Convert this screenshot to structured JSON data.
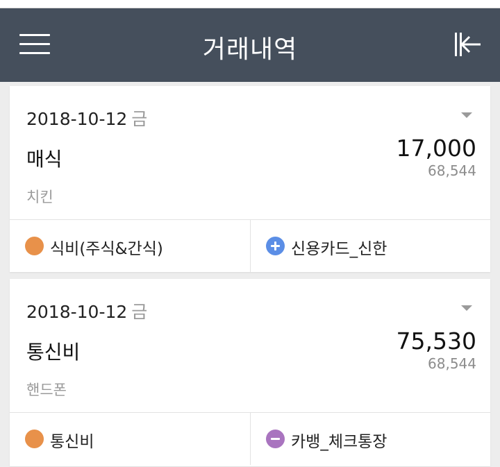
{
  "header": {
    "title": "거래내역",
    "menu_icon": "hamburger-icon",
    "back_icon": "collapse-left-icon",
    "bg_color": "#454f5c"
  },
  "transactions": [
    {
      "date": "2018-10-12",
      "weekday": "금",
      "item": "매식",
      "amount": "17,000",
      "balance": "68,544",
      "memo": "치킨",
      "category": {
        "label": "식비(주식&간식)",
        "color": "#e8914a"
      },
      "account": {
        "label": "신용카드_신한",
        "type": "plus",
        "color": "#5b8ee6"
      }
    },
    {
      "date": "2018-10-12",
      "weekday": "금",
      "item": "통신비",
      "amount": "75,530",
      "balance": "68,544",
      "memo": "핸드폰",
      "category": {
        "label": "통신비",
        "color": "#e8914a"
      },
      "account": {
        "label": "카뱅_체크통장",
        "type": "minus",
        "color": "#a974bf"
      }
    }
  ]
}
